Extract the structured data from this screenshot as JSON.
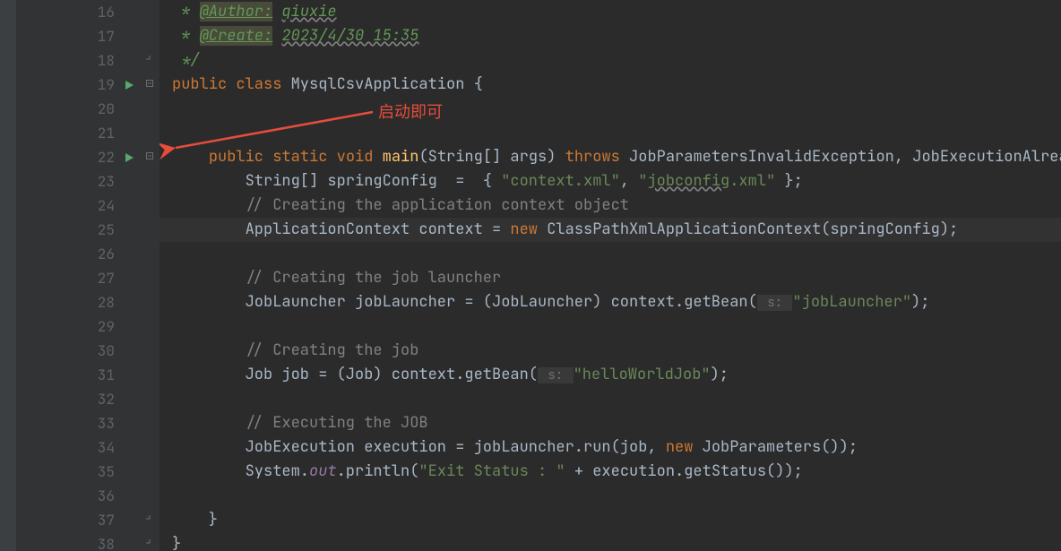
{
  "annotation": {
    "text": "启动即可"
  },
  "colors": {
    "keyword": "#cc7832",
    "string": "#6a8759",
    "comment": "#808080",
    "method": "#ffc66d",
    "static": "#9678a7",
    "arrow": "#e74c3c"
  },
  "lines": [
    {
      "n": 16,
      "kind": "doc",
      "tokens": [
        {
          "t": " * ",
          "c": "doc-cmt"
        },
        {
          "t": "@Author:",
          "c": "doc-tag"
        },
        {
          "t": " ",
          "c": "doc-cmt"
        },
        {
          "t": "qiuxie",
          "c": "doc-val"
        }
      ]
    },
    {
      "n": 17,
      "kind": "doc",
      "tokens": [
        {
          "t": " * ",
          "c": "doc-cmt"
        },
        {
          "t": "@Create:",
          "c": "doc-tag"
        },
        {
          "t": " ",
          "c": "doc-cmt"
        },
        {
          "t": "2023/4/30 15:35",
          "c": "doc-val"
        }
      ]
    },
    {
      "n": 18,
      "kind": "doc",
      "foldEnd": true,
      "tokens": [
        {
          "t": " */",
          "c": "doc-cmt"
        }
      ]
    },
    {
      "n": 19,
      "run": true,
      "foldStart": true,
      "sel": true,
      "tokens": [
        {
          "t": "public ",
          "c": "k"
        },
        {
          "t": "class ",
          "c": "k"
        },
        {
          "t": "MysqlCsvApplication ",
          "c": "cls"
        },
        {
          "t": "{",
          "c": "p"
        }
      ]
    },
    {
      "n": 20,
      "tokens": []
    },
    {
      "n": 21,
      "tokens": []
    },
    {
      "n": 22,
      "run": true,
      "foldStart": true,
      "tokens": [
        {
          "t": "    ",
          "c": "p"
        },
        {
          "t": "public ",
          "c": "k"
        },
        {
          "t": "static ",
          "c": "k"
        },
        {
          "t": "void ",
          "c": "k"
        },
        {
          "t": "main",
          "c": "fn"
        },
        {
          "t": "(String[] args) ",
          "c": "p"
        },
        {
          "t": "throws ",
          "c": "k"
        },
        {
          "t": "JobParametersInvalidException",
          "c": "cls"
        },
        {
          "t": ", ",
          "c": "p"
        },
        {
          "t": "JobExecutionAlready",
          "c": "cls"
        }
      ]
    },
    {
      "n": 23,
      "tokens": [
        {
          "t": "        String[] springConfig  =  { ",
          "c": "p"
        },
        {
          "t": "\"context.xml\"",
          "c": "str"
        },
        {
          "t": ", ",
          "c": "p"
        },
        {
          "t": "\"",
          "c": "str"
        },
        {
          "t": "jobconfig",
          "c": "str wavy"
        },
        {
          "t": ".xml\"",
          "c": "str"
        },
        {
          "t": " };",
          "c": "p"
        }
      ]
    },
    {
      "n": 24,
      "tokens": [
        {
          "t": "        ",
          "c": "p"
        },
        {
          "t": "// Creating the application context object",
          "c": "cmt"
        }
      ]
    },
    {
      "n": 25,
      "hl": true,
      "tokens": [
        {
          "t": "        ApplicationContext context = ",
          "c": "p"
        },
        {
          "t": "new ",
          "c": "k"
        },
        {
          "t": "ClassPathXmlApplicationContext(springConfig);",
          "c": "p"
        }
      ]
    },
    {
      "n": 26,
      "tokens": []
    },
    {
      "n": 27,
      "tokens": [
        {
          "t": "        ",
          "c": "p"
        },
        {
          "t": "// Creating the job launcher",
          "c": "cmt"
        }
      ]
    },
    {
      "n": 28,
      "tokens": [
        {
          "t": "        JobLauncher jobLauncher = (JobLauncher) context.getBean(",
          "c": "p"
        },
        {
          "t": " s: ",
          "c": "param-hint"
        },
        {
          "t": "\"jobLauncher\"",
          "c": "str"
        },
        {
          "t": ");",
          "c": "p"
        }
      ]
    },
    {
      "n": 29,
      "tokens": []
    },
    {
      "n": 30,
      "tokens": [
        {
          "t": "        ",
          "c": "p"
        },
        {
          "t": "// Creating the job",
          "c": "cmt"
        }
      ]
    },
    {
      "n": 31,
      "tokens": [
        {
          "t": "        Job job = (Job) context.getBean(",
          "c": "p"
        },
        {
          "t": " s: ",
          "c": "param-hint"
        },
        {
          "t": "\"helloWorldJob\"",
          "c": "str"
        },
        {
          "t": ");",
          "c": "p"
        }
      ]
    },
    {
      "n": 32,
      "tokens": []
    },
    {
      "n": 33,
      "tokens": [
        {
          "t": "        ",
          "c": "p"
        },
        {
          "t": "// Executing the JOB",
          "c": "cmt"
        }
      ]
    },
    {
      "n": 34,
      "tokens": [
        {
          "t": "        JobExecution execution = jobLauncher.run(job, ",
          "c": "p"
        },
        {
          "t": "new ",
          "c": "k"
        },
        {
          "t": "JobParameters());",
          "c": "p"
        }
      ]
    },
    {
      "n": 35,
      "tokens": [
        {
          "t": "        System.",
          "c": "p"
        },
        {
          "t": "out",
          "c": "sta"
        },
        {
          "t": ".println(",
          "c": "p"
        },
        {
          "t": "\"Exit Status : \"",
          "c": "str"
        },
        {
          "t": " + execution.getStatus());",
          "c": "p"
        }
      ]
    },
    {
      "n": 36,
      "tokens": []
    },
    {
      "n": 37,
      "foldEnd": true,
      "tokens": [
        {
          "t": "    }",
          "c": "p"
        }
      ]
    },
    {
      "n": 38,
      "foldEnd": true,
      "tokens": [
        {
          "t": "}",
          "c": "p"
        }
      ]
    }
  ]
}
